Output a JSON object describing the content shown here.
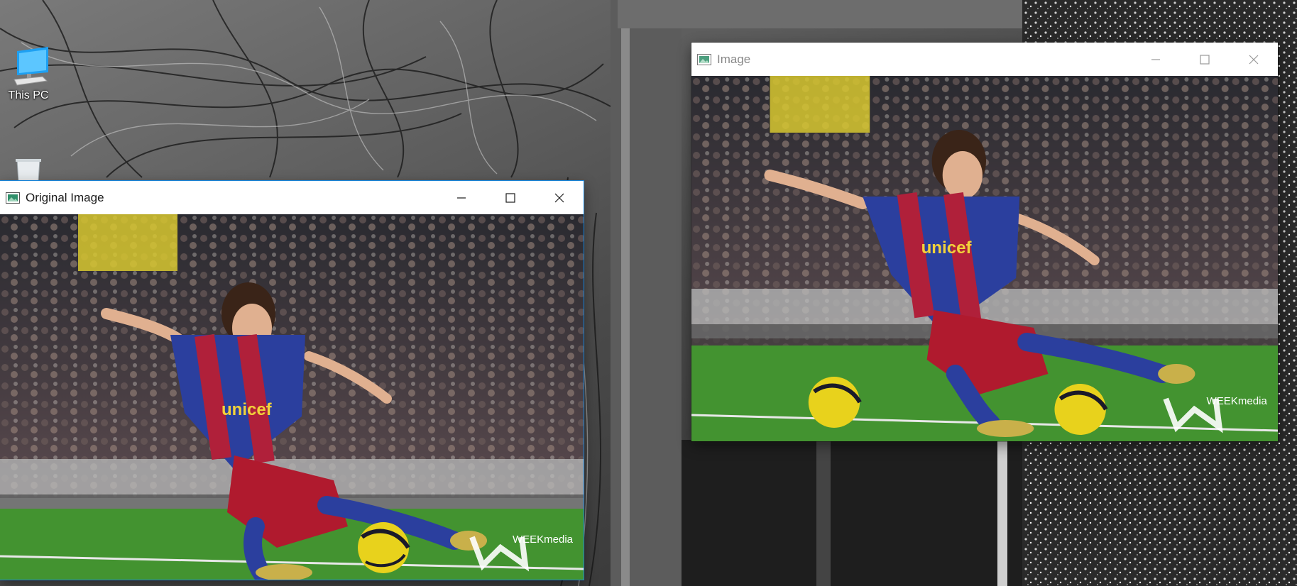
{
  "desktop": {
    "icons": [
      {
        "label": "This PC",
        "icon": "computer-icon"
      },
      {
        "label": "",
        "icon": "recycle-bin-icon"
      }
    ]
  },
  "windows": {
    "original": {
      "title": "Original Image",
      "app_icon": "image-window-icon",
      "state": "active",
      "buttons": [
        "minimize",
        "maximize",
        "close"
      ],
      "image_watermark": "WEEKmedia",
      "jersey_text": "unicef"
    },
    "processed": {
      "title": "Image",
      "app_icon": "image-window-icon",
      "state": "inactive",
      "buttons": [
        "minimize",
        "maximize",
        "close"
      ],
      "image_watermark": "WEEKmedia",
      "jersey_text": "unicef"
    }
  },
  "colors": {
    "accent_border": "#1883d7",
    "title_active": "#1a1a1a",
    "title_inactive": "#888888",
    "pitch_green": "#3d8a2c",
    "jersey_blue": "#2b3f9e",
    "jersey_red": "#b0203a",
    "ball_yellow": "#e8d21c"
  }
}
